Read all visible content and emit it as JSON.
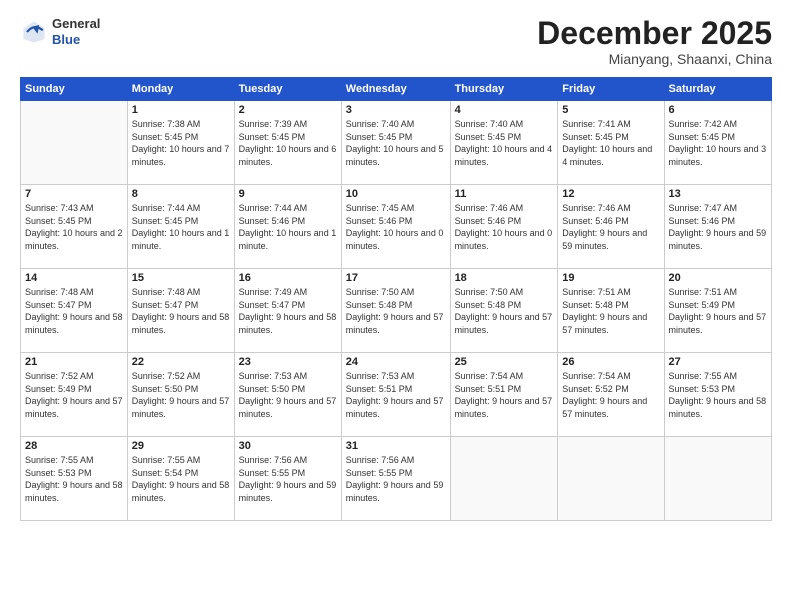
{
  "header": {
    "logo_general": "General",
    "logo_blue": "Blue",
    "month_title": "December 2025",
    "location": "Mianyang, Shaanxi, China"
  },
  "days_of_week": [
    "Sunday",
    "Monday",
    "Tuesday",
    "Wednesday",
    "Thursday",
    "Friday",
    "Saturday"
  ],
  "weeks": [
    [
      {
        "day": "",
        "sunrise": "",
        "sunset": "",
        "daylight": ""
      },
      {
        "day": "1",
        "sunrise": "Sunrise: 7:38 AM",
        "sunset": "Sunset: 5:45 PM",
        "daylight": "Daylight: 10 hours and 7 minutes."
      },
      {
        "day": "2",
        "sunrise": "Sunrise: 7:39 AM",
        "sunset": "Sunset: 5:45 PM",
        "daylight": "Daylight: 10 hours and 6 minutes."
      },
      {
        "day": "3",
        "sunrise": "Sunrise: 7:40 AM",
        "sunset": "Sunset: 5:45 PM",
        "daylight": "Daylight: 10 hours and 5 minutes."
      },
      {
        "day": "4",
        "sunrise": "Sunrise: 7:40 AM",
        "sunset": "Sunset: 5:45 PM",
        "daylight": "Daylight: 10 hours and 4 minutes."
      },
      {
        "day": "5",
        "sunrise": "Sunrise: 7:41 AM",
        "sunset": "Sunset: 5:45 PM",
        "daylight": "Daylight: 10 hours and 4 minutes."
      },
      {
        "day": "6",
        "sunrise": "Sunrise: 7:42 AM",
        "sunset": "Sunset: 5:45 PM",
        "daylight": "Daylight: 10 hours and 3 minutes."
      }
    ],
    [
      {
        "day": "7",
        "sunrise": "Sunrise: 7:43 AM",
        "sunset": "Sunset: 5:45 PM",
        "daylight": "Daylight: 10 hours and 2 minutes."
      },
      {
        "day": "8",
        "sunrise": "Sunrise: 7:44 AM",
        "sunset": "Sunset: 5:45 PM",
        "daylight": "Daylight: 10 hours and 1 minute."
      },
      {
        "day": "9",
        "sunrise": "Sunrise: 7:44 AM",
        "sunset": "Sunset: 5:46 PM",
        "daylight": "Daylight: 10 hours and 1 minute."
      },
      {
        "day": "10",
        "sunrise": "Sunrise: 7:45 AM",
        "sunset": "Sunset: 5:46 PM",
        "daylight": "Daylight: 10 hours and 0 minutes."
      },
      {
        "day": "11",
        "sunrise": "Sunrise: 7:46 AM",
        "sunset": "Sunset: 5:46 PM",
        "daylight": "Daylight: 10 hours and 0 minutes."
      },
      {
        "day": "12",
        "sunrise": "Sunrise: 7:46 AM",
        "sunset": "Sunset: 5:46 PM",
        "daylight": "Daylight: 9 hours and 59 minutes."
      },
      {
        "day": "13",
        "sunrise": "Sunrise: 7:47 AM",
        "sunset": "Sunset: 5:46 PM",
        "daylight": "Daylight: 9 hours and 59 minutes."
      }
    ],
    [
      {
        "day": "14",
        "sunrise": "Sunrise: 7:48 AM",
        "sunset": "Sunset: 5:47 PM",
        "daylight": "Daylight: 9 hours and 58 minutes."
      },
      {
        "day": "15",
        "sunrise": "Sunrise: 7:48 AM",
        "sunset": "Sunset: 5:47 PM",
        "daylight": "Daylight: 9 hours and 58 minutes."
      },
      {
        "day": "16",
        "sunrise": "Sunrise: 7:49 AM",
        "sunset": "Sunset: 5:47 PM",
        "daylight": "Daylight: 9 hours and 58 minutes."
      },
      {
        "day": "17",
        "sunrise": "Sunrise: 7:50 AM",
        "sunset": "Sunset: 5:48 PM",
        "daylight": "Daylight: 9 hours and 57 minutes."
      },
      {
        "day": "18",
        "sunrise": "Sunrise: 7:50 AM",
        "sunset": "Sunset: 5:48 PM",
        "daylight": "Daylight: 9 hours and 57 minutes."
      },
      {
        "day": "19",
        "sunrise": "Sunrise: 7:51 AM",
        "sunset": "Sunset: 5:48 PM",
        "daylight": "Daylight: 9 hours and 57 minutes."
      },
      {
        "day": "20",
        "sunrise": "Sunrise: 7:51 AM",
        "sunset": "Sunset: 5:49 PM",
        "daylight": "Daylight: 9 hours and 57 minutes."
      }
    ],
    [
      {
        "day": "21",
        "sunrise": "Sunrise: 7:52 AM",
        "sunset": "Sunset: 5:49 PM",
        "daylight": "Daylight: 9 hours and 57 minutes."
      },
      {
        "day": "22",
        "sunrise": "Sunrise: 7:52 AM",
        "sunset": "Sunset: 5:50 PM",
        "daylight": "Daylight: 9 hours and 57 minutes."
      },
      {
        "day": "23",
        "sunrise": "Sunrise: 7:53 AM",
        "sunset": "Sunset: 5:50 PM",
        "daylight": "Daylight: 9 hours and 57 minutes."
      },
      {
        "day": "24",
        "sunrise": "Sunrise: 7:53 AM",
        "sunset": "Sunset: 5:51 PM",
        "daylight": "Daylight: 9 hours and 57 minutes."
      },
      {
        "day": "25",
        "sunrise": "Sunrise: 7:54 AM",
        "sunset": "Sunset: 5:51 PM",
        "daylight": "Daylight: 9 hours and 57 minutes."
      },
      {
        "day": "26",
        "sunrise": "Sunrise: 7:54 AM",
        "sunset": "Sunset: 5:52 PM",
        "daylight": "Daylight: 9 hours and 57 minutes."
      },
      {
        "day": "27",
        "sunrise": "Sunrise: 7:55 AM",
        "sunset": "Sunset: 5:53 PM",
        "daylight": "Daylight: 9 hours and 58 minutes."
      }
    ],
    [
      {
        "day": "28",
        "sunrise": "Sunrise: 7:55 AM",
        "sunset": "Sunset: 5:53 PM",
        "daylight": "Daylight: 9 hours and 58 minutes."
      },
      {
        "day": "29",
        "sunrise": "Sunrise: 7:55 AM",
        "sunset": "Sunset: 5:54 PM",
        "daylight": "Daylight: 9 hours and 58 minutes."
      },
      {
        "day": "30",
        "sunrise": "Sunrise: 7:56 AM",
        "sunset": "Sunset: 5:55 PM",
        "daylight": "Daylight: 9 hours and 59 minutes."
      },
      {
        "day": "31",
        "sunrise": "Sunrise: 7:56 AM",
        "sunset": "Sunset: 5:55 PM",
        "daylight": "Daylight: 9 hours and 59 minutes."
      },
      {
        "day": "",
        "sunrise": "",
        "sunset": "",
        "daylight": ""
      },
      {
        "day": "",
        "sunrise": "",
        "sunset": "",
        "daylight": ""
      },
      {
        "day": "",
        "sunrise": "",
        "sunset": "",
        "daylight": ""
      }
    ]
  ]
}
